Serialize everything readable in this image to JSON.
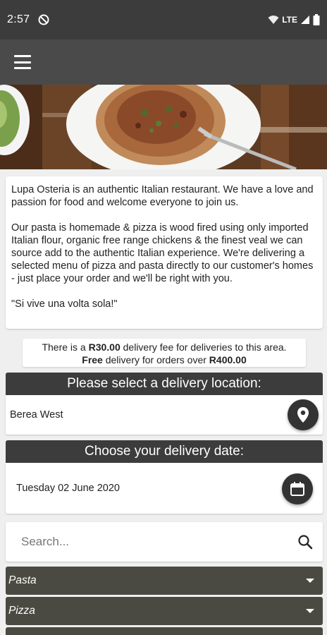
{
  "status_bar": {
    "time": "2:57",
    "network": "LTE"
  },
  "about": {
    "paragraph1": "Lupa Osteria is an authentic Italian restaurant. We have a love and passion for food and welcome everyone to join us.",
    "paragraph2": "Our pasta is homemade & pizza is wood fired using only imported Italian flour, organic free range chickens & the finest veal we can source add to the authentic Italian experience. We're delivering a selected menu of pizza and pasta directly to our customer's homes - just place your order and we'll be right with you.",
    "paragraph3": "\"Si vive una volta sola!\""
  },
  "fee": {
    "line1_prefix": "There is a ",
    "line1_amount": "R30.00",
    "line1_suffix": " delivery fee for deliveries to this area.",
    "line2_free": "Free",
    "line2_middle": " delivery for orders over ",
    "line2_amount": "R400.00"
  },
  "location": {
    "header": "Please select a delivery location:",
    "value": "Berea West"
  },
  "delivery_date": {
    "header": "Choose your delivery date:",
    "value": "Tuesday 02 June 2020"
  },
  "search": {
    "placeholder": "Search..."
  },
  "categories": [
    {
      "label": "Pasta"
    },
    {
      "label": "Pizza"
    }
  ],
  "colors": {
    "status_bar": "#3c3c3c",
    "app_bar": "#4a4a4a",
    "section_header": "#3c3c3c",
    "category_bg": "#4a4a42",
    "background": "#efefef"
  },
  "icons": [
    "menu-icon",
    "location-pin-icon",
    "calendar-icon",
    "search-icon",
    "chevron-down-icon",
    "wifi-icon",
    "signal-icon",
    "battery-icon",
    "dnd-icon"
  ]
}
